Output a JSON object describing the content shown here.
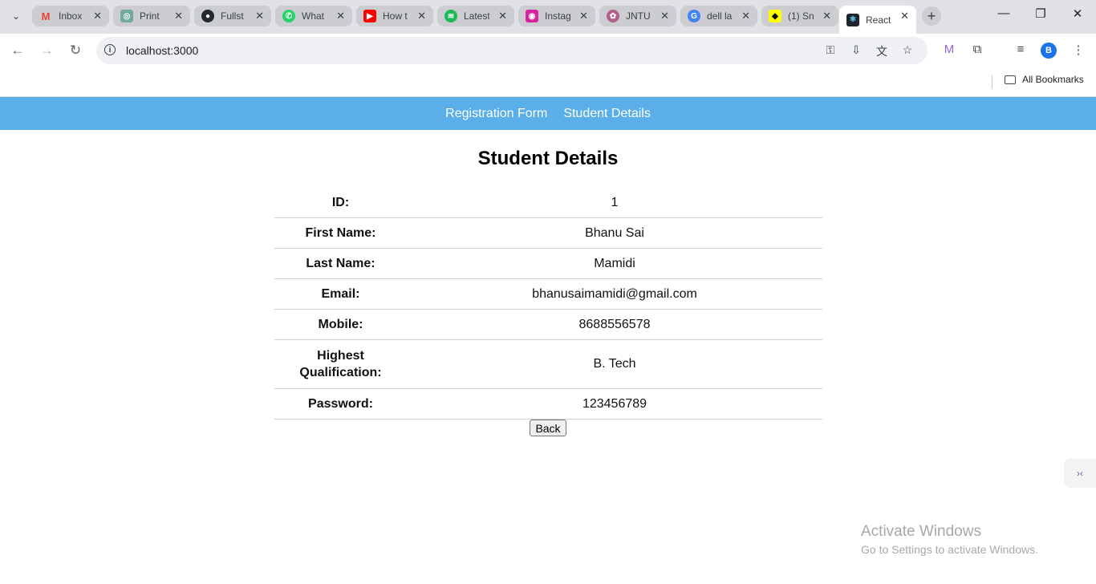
{
  "browser": {
    "tabs": [
      {
        "title": "Inbox",
        "icon": "gmail-icon",
        "color": "#ea4335",
        "glyph": "M"
      },
      {
        "title": "Print",
        "icon": "chatgpt-icon",
        "color": "#74aa9c",
        "glyph": "◎"
      },
      {
        "title": "Fullst",
        "icon": "github-icon",
        "color": "#24292e",
        "glyph": "●"
      },
      {
        "title": "What",
        "icon": "whatsapp-icon",
        "color": "#25d366",
        "glyph": "✆"
      },
      {
        "title": "How t",
        "icon": "youtube-icon",
        "color": "#ff0000",
        "glyph": "▶"
      },
      {
        "title": "Latest",
        "icon": "spotify-icon",
        "color": "#1db954",
        "glyph": "≋"
      },
      {
        "title": "Instag",
        "icon": "instagram-icon",
        "color": "#d6249f",
        "glyph": "◉"
      },
      {
        "title": "JNTU",
        "icon": "jntu-icon",
        "color": "#b0608a",
        "glyph": "✿"
      },
      {
        "title": "dell la",
        "icon": "google-icon",
        "color": "#4285f4",
        "glyph": "G"
      },
      {
        "title": "(1) Sn",
        "icon": "snapchat-icon",
        "color": "#fffc00",
        "glyph": "◆"
      },
      {
        "title": "React",
        "icon": "react-icon",
        "color": "#20232a",
        "glyph": "⚛"
      }
    ],
    "url": "localhost:3000",
    "bookmarks_label": "All Bookmarks",
    "avatar_letter": "B"
  },
  "nav": {
    "registration_link": "Registration Form",
    "details_link": "Student Details"
  },
  "page": {
    "heading": "Student Details",
    "back_label": "Back"
  },
  "fields": [
    {
      "label": "ID:",
      "value": "1"
    },
    {
      "label": "First Name:",
      "value": "Bhanu Sai"
    },
    {
      "label": "Last Name:",
      "value": "Mamidi"
    },
    {
      "label": "Email:",
      "value": "bhanusaimamidi@gmail.com"
    },
    {
      "label": "Mobile:",
      "value": "8688556578"
    },
    {
      "label": "Highest Qualification:",
      "value": "B. Tech"
    },
    {
      "label": "Password:",
      "value": "123456789"
    }
  ],
  "watermark": {
    "line1": "Activate Windows",
    "line2": "Go to Settings to activate Windows."
  },
  "colors": {
    "nav_bg": "#5aafe8",
    "avatar": "#1a73e8"
  }
}
